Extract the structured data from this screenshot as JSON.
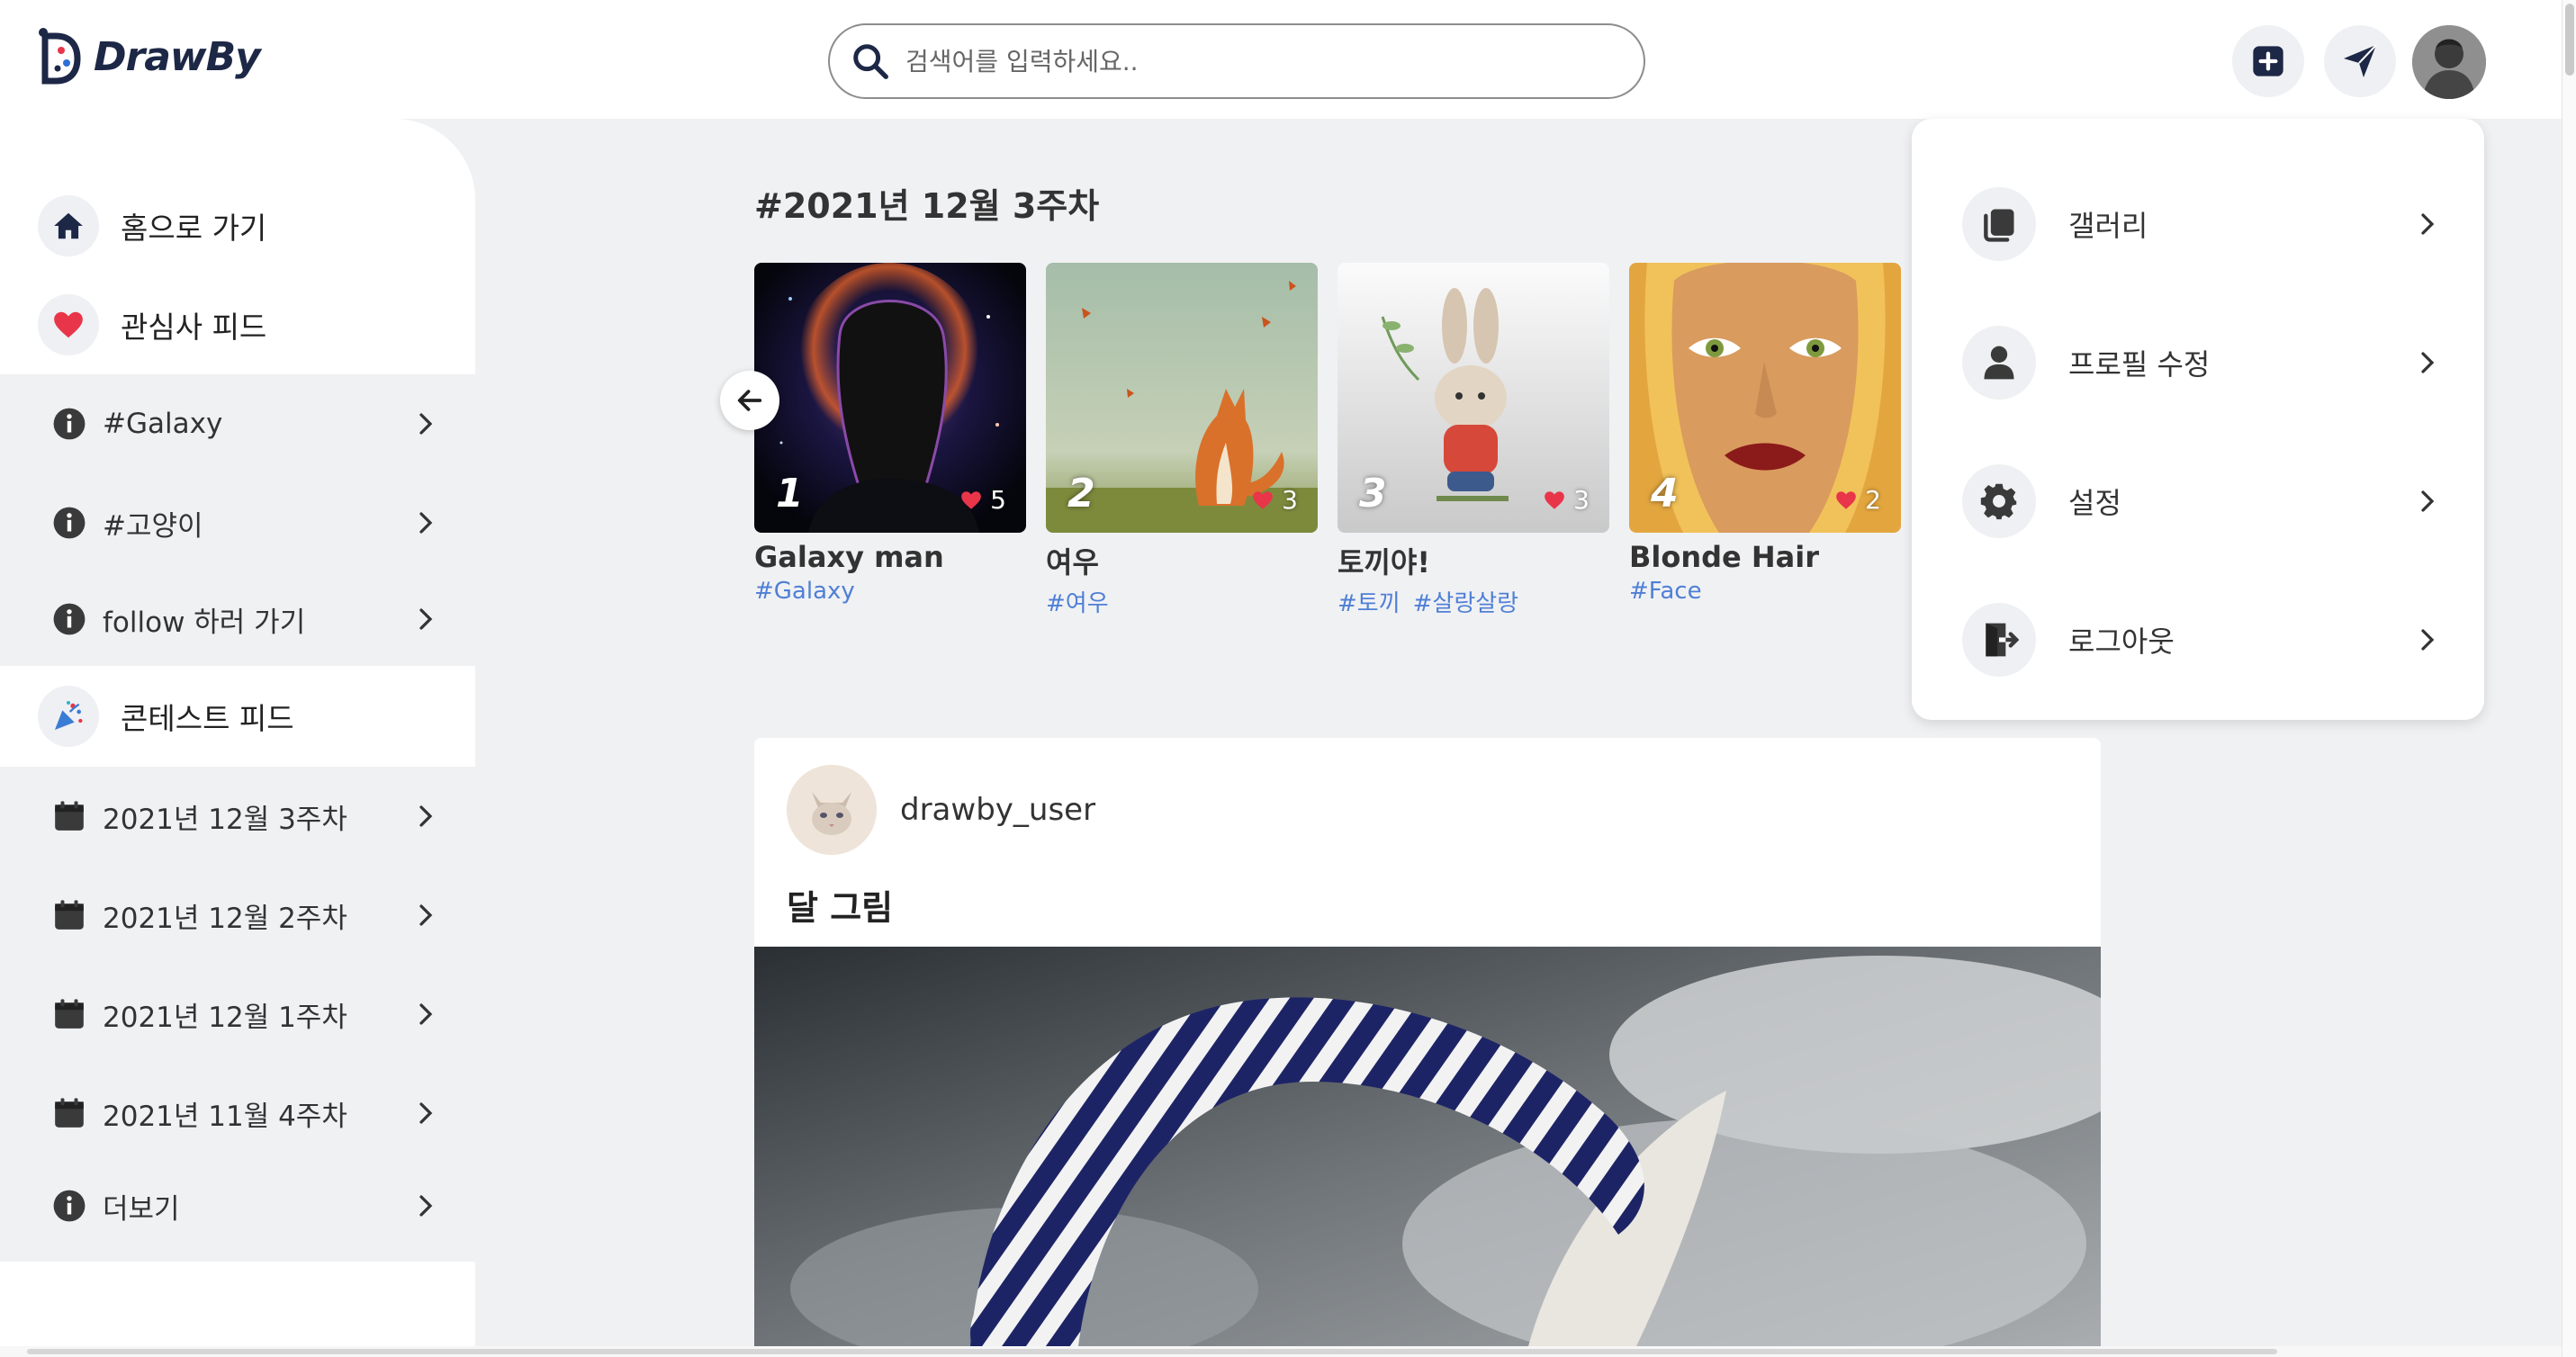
{
  "app": {
    "name": "DrawBy"
  },
  "search": {
    "placeholder": "검색어를 입력하세요.."
  },
  "sidebar": {
    "home_label": "홈으로 가기",
    "interest_label": "관심사 피드",
    "interests": [
      {
        "label": "#Galaxy",
        "icon": "info-icon"
      },
      {
        "label": "#고양이",
        "icon": "info-icon"
      },
      {
        "label": "follow 하러 가기",
        "icon": "info-icon"
      }
    ],
    "contest_label": "콘테스트 피드",
    "contests": [
      {
        "label": "2021년 12월 3주차",
        "icon": "calendar-icon"
      },
      {
        "label": "2021년 12월 2주차",
        "icon": "calendar-icon"
      },
      {
        "label": "2021년 12월 1주차",
        "icon": "calendar-icon"
      },
      {
        "label": "2021년 11월 4주차",
        "icon": "calendar-icon"
      },
      {
        "label": "더보기",
        "icon": "info-icon"
      }
    ]
  },
  "contest": {
    "title": "#2021년 12월 3주차",
    "ranks": [
      {
        "rank": "1",
        "name": "Galaxy man",
        "likes": "5",
        "tags": [
          "#Galaxy"
        ]
      },
      {
        "rank": "2",
        "name": "여우",
        "likes": "3",
        "tags": [
          "#여우"
        ]
      },
      {
        "rank": "3",
        "name": "토끼야!",
        "likes": "3",
        "tags": [
          "#토끼",
          "#살랑살랑"
        ]
      },
      {
        "rank": "4",
        "name": "Blonde Hair",
        "likes": "2",
        "tags": [
          "#Face"
        ]
      }
    ]
  },
  "post": {
    "username": "drawby_user",
    "title": "달 그림"
  },
  "menu": {
    "items": [
      {
        "label": "갤러리",
        "icon": "gallery-icon"
      },
      {
        "label": "프로필 수정",
        "icon": "user-icon"
      },
      {
        "label": "설정",
        "icon": "gear-icon"
      },
      {
        "label": "로그아웃",
        "icon": "logout-icon"
      }
    ]
  },
  "colors": {
    "accent": "#1d2746",
    "like": "#e8354a",
    "tag": "#4f7fd6",
    "background": "#f0f1f3"
  }
}
